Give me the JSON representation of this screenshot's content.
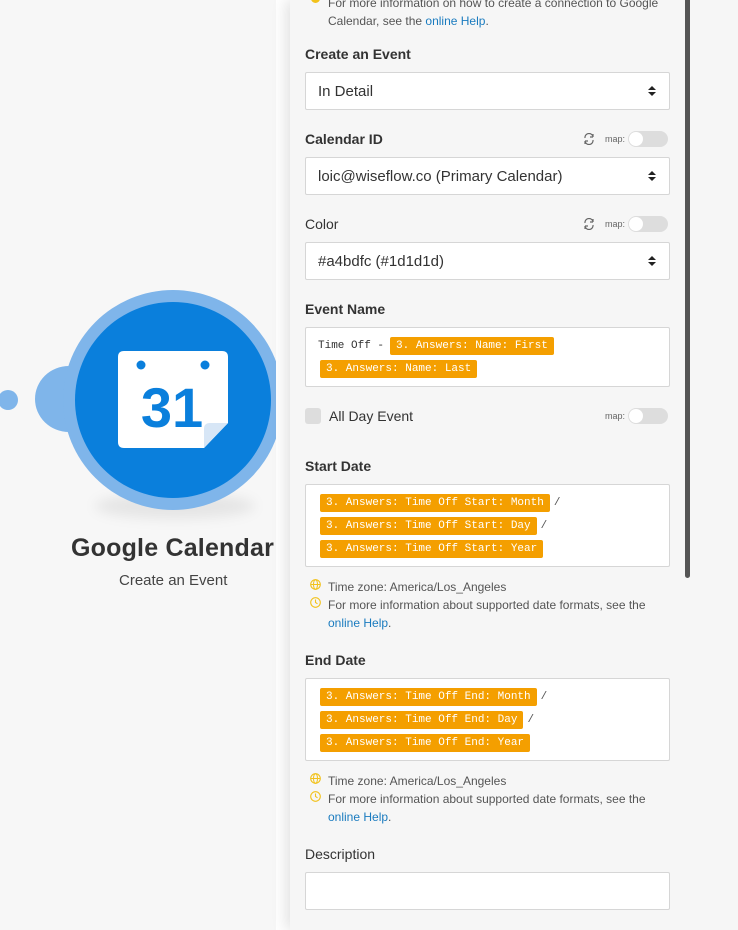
{
  "module": {
    "title": "Google Calendar",
    "subtitle": "Create an Event",
    "icon": "google-calendar-icon",
    "icon_number": "31",
    "brand_color": "#0a7fdc",
    "ring_color": "#7fb5ea"
  },
  "panel": {
    "help_top": {
      "line1": "For more information on how to create a connection to Google",
      "line2_prefix": "Calendar, see the ",
      "link": "online Help",
      "line2_suffix": "."
    },
    "map_label": "map:",
    "create_event": {
      "label": "Create an Event",
      "value": "In Detail"
    },
    "calendar_id": {
      "label": "Calendar ID",
      "value": "loic@wiseflow.co (Primary Calendar)"
    },
    "color": {
      "label": "Color",
      "value": "#a4bdfc (#1d1d1d)"
    },
    "event_name": {
      "label": "Event Name",
      "prefix": "Time Off - ",
      "tokens": [
        "3. Answers: Name: First",
        "3. Answers: Name: Last"
      ]
    },
    "all_day": {
      "label": "All Day Event"
    },
    "start_date": {
      "label": "Start Date",
      "tokens": [
        "3. Answers: Time Off Start: Month",
        "3. Answers: Time Off Start: Day",
        "3. Answers: Time Off Start: Year"
      ],
      "separator": "/",
      "timezone": "Time zone: America/Los_Angeles",
      "format_help": "For more information about supported date formats, see the",
      "format_link": "online Help",
      "format_suffix": "."
    },
    "end_date": {
      "label": "End Date",
      "tokens": [
        "3. Answers: Time Off End: Month",
        "3. Answers: Time Off End: Day",
        "3. Answers: Time Off End: Year"
      ],
      "separator": "/",
      "timezone": "Time zone: America/Los_Angeles",
      "format_help": "For more information about supported date formats, see the",
      "format_link": "online Help",
      "format_suffix": "."
    },
    "description": {
      "label": "Description",
      "value": ""
    },
    "token_color": "#f49f00",
    "link_color": "#1a7bbf"
  }
}
